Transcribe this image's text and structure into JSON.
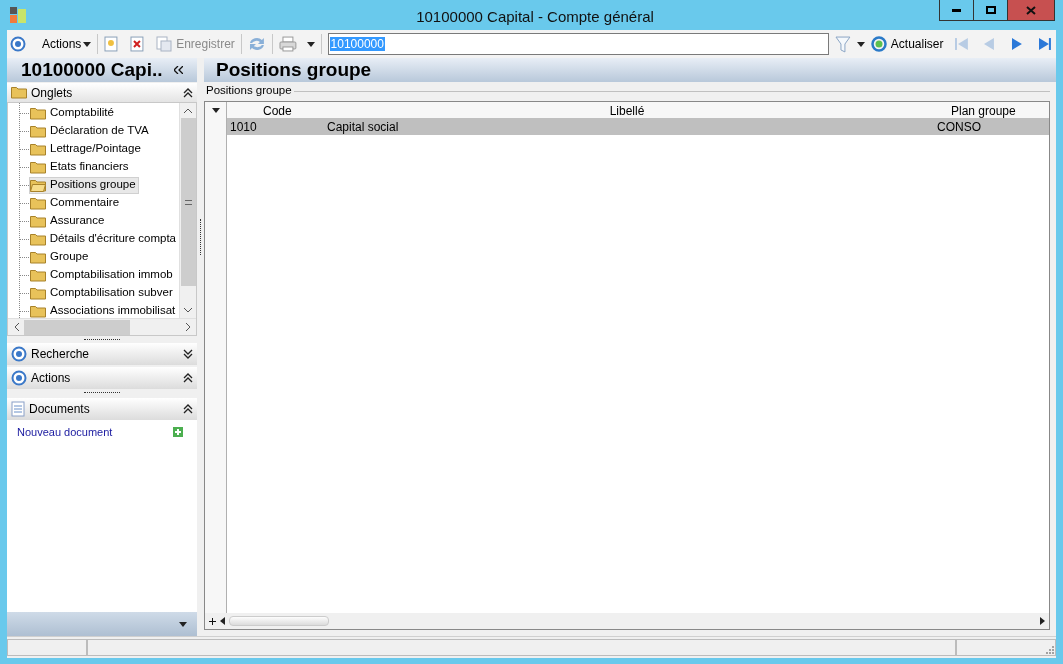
{
  "window": {
    "title": "10100000 Capital -  Compte général"
  },
  "toolbar": {
    "actions_label": "Actions",
    "save_label": "Enregistrer",
    "search_value": "10100000",
    "refresh_label": "Actualiser"
  },
  "left_panel": {
    "title": "10100000 Capi..",
    "tabs_header": "Onglets",
    "tree_items": [
      {
        "label": "Comptabilité",
        "selected": false
      },
      {
        "label": "Déclaration de TVA",
        "selected": false
      },
      {
        "label": "Lettrage/Pointage",
        "selected": false
      },
      {
        "label": "Etats financiers",
        "selected": false
      },
      {
        "label": "Positions groupe",
        "selected": true
      },
      {
        "label": "Commentaire",
        "selected": false
      },
      {
        "label": "Assurance",
        "selected": false
      },
      {
        "label": "Détails d'écriture compta",
        "selected": false
      },
      {
        "label": "Groupe",
        "selected": false
      },
      {
        "label": "Comptabilisation immob",
        "selected": false
      },
      {
        "label": "Comptabilisation subver",
        "selected": false
      },
      {
        "label": "Associations immobilisat",
        "selected": false
      }
    ],
    "sections": [
      {
        "label": "Recherche",
        "kind": "radio",
        "expanded": false
      },
      {
        "label": "Actions",
        "kind": "radio",
        "expanded": true
      },
      {
        "label": "Documents",
        "kind": "document",
        "expanded": true
      }
    ],
    "documents_link": "Nouveau document"
  },
  "content": {
    "title": "Positions groupe",
    "group_label": "Positions groupe",
    "table": {
      "columns": [
        "Code",
        "Libellé",
        "Plan groupe"
      ],
      "rows": [
        {
          "cells": [
            "1010",
            "Capital social",
            "CONSO"
          ],
          "selected": true
        }
      ]
    }
  }
}
